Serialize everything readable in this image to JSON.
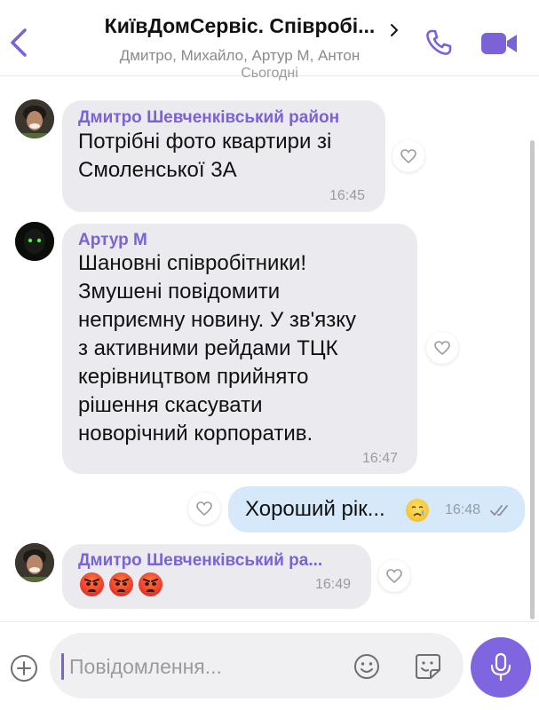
{
  "header": {
    "title": "КиївДомСервіс. Співробі...",
    "subtitle": "Дмитро, Михайло, Артур М, Антон"
  },
  "date_separator": "Сьогодні",
  "messages": [
    {
      "sender": "Дмитро Шевченківський район",
      "line1": "Потрібні фото квартири зі",
      "line2": "Смоленської 3А",
      "time": "16:45",
      "avatar": "avatar-photo-man"
    },
    {
      "sender": "Артур М",
      "line1": "Шановні співробітники!",
      "line2": "Змушені повідомити",
      "line3": "неприємну новину. У зв'язку",
      "line4": "з активними рейдами ТЦК",
      "line5": "керівництвом прийнято",
      "line6": "рішення скасувати",
      "line7": "новорічний корпоратив.",
      "time": "16:47",
      "avatar": "avatar-dark-figure"
    },
    {
      "text": "Хороший рік...",
      "emoji": "crying-face",
      "time": "16:48",
      "status": "read-double-check"
    },
    {
      "sender": "Дмитро Шевченківський ра...",
      "emojis": [
        "angry-face",
        "angry-face",
        "angry-face"
      ],
      "time": "16:49",
      "avatar": "avatar-photo-man"
    }
  ],
  "composer": {
    "placeholder": "Повідомлення..."
  },
  "icons": [
    "back-icon",
    "chevron-right-icon",
    "phone-icon",
    "video-icon",
    "heart-icon",
    "plus-icon",
    "smile-icon",
    "sticker-icon",
    "microphone-icon"
  ],
  "colors": {
    "accent": "#7b62d6",
    "incoming_bubble": "#ebebef",
    "outgoing_bubble": "#d5e9fb",
    "mic_button": "#7f66e0"
  }
}
